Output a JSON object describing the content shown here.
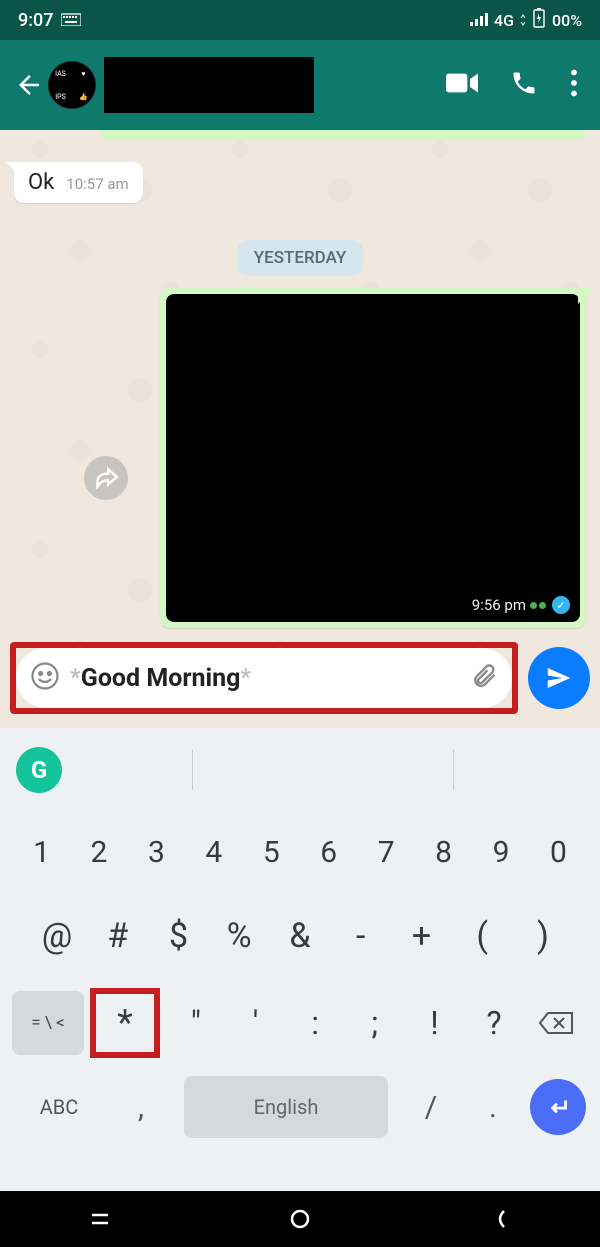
{
  "status": {
    "time": "9:07",
    "network": "4G",
    "battery": "00%"
  },
  "chat": {
    "ok_text": "Ok",
    "ok_time": "10:57 am",
    "date_label": "YESTERDAY",
    "image_time": "9:56 pm"
  },
  "input": {
    "prefix": "*",
    "text": "Good Morning",
    "suffix": "*"
  },
  "keyboard": {
    "row1": [
      "1",
      "2",
      "3",
      "4",
      "5",
      "6",
      "7",
      "8",
      "9",
      "0"
    ],
    "row2": [
      "@",
      "#",
      "$",
      "%",
      "&",
      "-",
      "+",
      "(",
      ")"
    ],
    "switch2": "= \\ <",
    "star": "*",
    "row3": [
      "\"",
      "'",
      ":",
      ";",
      "!",
      "?"
    ],
    "abc": "ABC",
    "comma": ",",
    "space": "English",
    "slash": "/",
    "period": "."
  }
}
